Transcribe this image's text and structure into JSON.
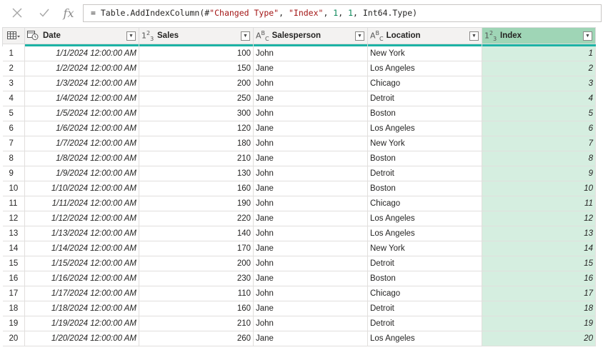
{
  "formula_bar": {
    "cancel_icon": "close-icon",
    "confirm_icon": "checkmark-icon",
    "fx_label": "fx",
    "formula_prefix": "= Table.AddIndexColumn(#",
    "formula_arg1": "\"Changed Type\"",
    "formula_sep1": ", ",
    "formula_arg2": "\"Index\"",
    "formula_sep2": ", ",
    "formula_arg3": "1",
    "formula_sep3": ", ",
    "formula_arg4": "1",
    "formula_suffix": ", Int64.Type)"
  },
  "colors": {
    "selected_header": "#9fd5b6",
    "selected_column": "#d5eee0",
    "quality_bar": "#1db3a5"
  },
  "columns": [
    {
      "label": "Date",
      "type_icon": "date-time-type-icon"
    },
    {
      "label": "Sales",
      "type_icon": "whole-number-type-icon"
    },
    {
      "label": "Salesperson",
      "type_icon": "text-type-icon"
    },
    {
      "label": "Location",
      "type_icon": "text-type-icon"
    },
    {
      "label": "Index",
      "type_icon": "whole-number-type-icon",
      "selected": true
    }
  ],
  "rows": [
    {
      "n": "1",
      "date": "1/1/2024 12:00:00 AM",
      "sales": "100",
      "salesperson": "John",
      "location": "New York",
      "index": "1"
    },
    {
      "n": "2",
      "date": "1/2/2024 12:00:00 AM",
      "sales": "150",
      "salesperson": "Jane",
      "location": "Los Angeles",
      "index": "2"
    },
    {
      "n": "3",
      "date": "1/3/2024 12:00:00 AM",
      "sales": "200",
      "salesperson": "John",
      "location": "Chicago",
      "index": "3"
    },
    {
      "n": "4",
      "date": "1/4/2024 12:00:00 AM",
      "sales": "250",
      "salesperson": "Jane",
      "location": "Detroit",
      "index": "4"
    },
    {
      "n": "5",
      "date": "1/5/2024 12:00:00 AM",
      "sales": "300",
      "salesperson": "John",
      "location": "Boston",
      "index": "5"
    },
    {
      "n": "6",
      "date": "1/6/2024 12:00:00 AM",
      "sales": "120",
      "salesperson": "Jane",
      "location": "Los Angeles",
      "index": "6"
    },
    {
      "n": "7",
      "date": "1/7/2024 12:00:00 AM",
      "sales": "180",
      "salesperson": "John",
      "location": "New York",
      "index": "7"
    },
    {
      "n": "8",
      "date": "1/8/2024 12:00:00 AM",
      "sales": "210",
      "salesperson": "Jane",
      "location": "Boston",
      "index": "8"
    },
    {
      "n": "9",
      "date": "1/9/2024 12:00:00 AM",
      "sales": "130",
      "salesperson": "John",
      "location": "Detroit",
      "index": "9"
    },
    {
      "n": "10",
      "date": "1/10/2024 12:00:00 AM",
      "sales": "160",
      "salesperson": "Jane",
      "location": "Boston",
      "index": "10"
    },
    {
      "n": "11",
      "date": "1/11/2024 12:00:00 AM",
      "sales": "190",
      "salesperson": "John",
      "location": "Chicago",
      "index": "11"
    },
    {
      "n": "12",
      "date": "1/12/2024 12:00:00 AM",
      "sales": "220",
      "salesperson": "Jane",
      "location": "Los Angeles",
      "index": "12"
    },
    {
      "n": "13",
      "date": "1/13/2024 12:00:00 AM",
      "sales": "140",
      "salesperson": "John",
      "location": "Los Angeles",
      "index": "13"
    },
    {
      "n": "14",
      "date": "1/14/2024 12:00:00 AM",
      "sales": "170",
      "salesperson": "Jane",
      "location": "New York",
      "index": "14"
    },
    {
      "n": "15",
      "date": "1/15/2024 12:00:00 AM",
      "sales": "200",
      "salesperson": "John",
      "location": "Detroit",
      "index": "15"
    },
    {
      "n": "16",
      "date": "1/16/2024 12:00:00 AM",
      "sales": "230",
      "salesperson": "Jane",
      "location": "Boston",
      "index": "16"
    },
    {
      "n": "17",
      "date": "1/17/2024 12:00:00 AM",
      "sales": "110",
      "salesperson": "John",
      "location": "Chicago",
      "index": "17"
    },
    {
      "n": "18",
      "date": "1/18/2024 12:00:00 AM",
      "sales": "160",
      "salesperson": "Jane",
      "location": "Detroit",
      "index": "18"
    },
    {
      "n": "19",
      "date": "1/19/2024 12:00:00 AM",
      "sales": "210",
      "salesperson": "John",
      "location": "Detroit",
      "index": "19"
    },
    {
      "n": "20",
      "date": "1/20/2024 12:00:00 AM",
      "sales": "260",
      "salesperson": "Jane",
      "location": "Los Angeles",
      "index": "20"
    }
  ]
}
